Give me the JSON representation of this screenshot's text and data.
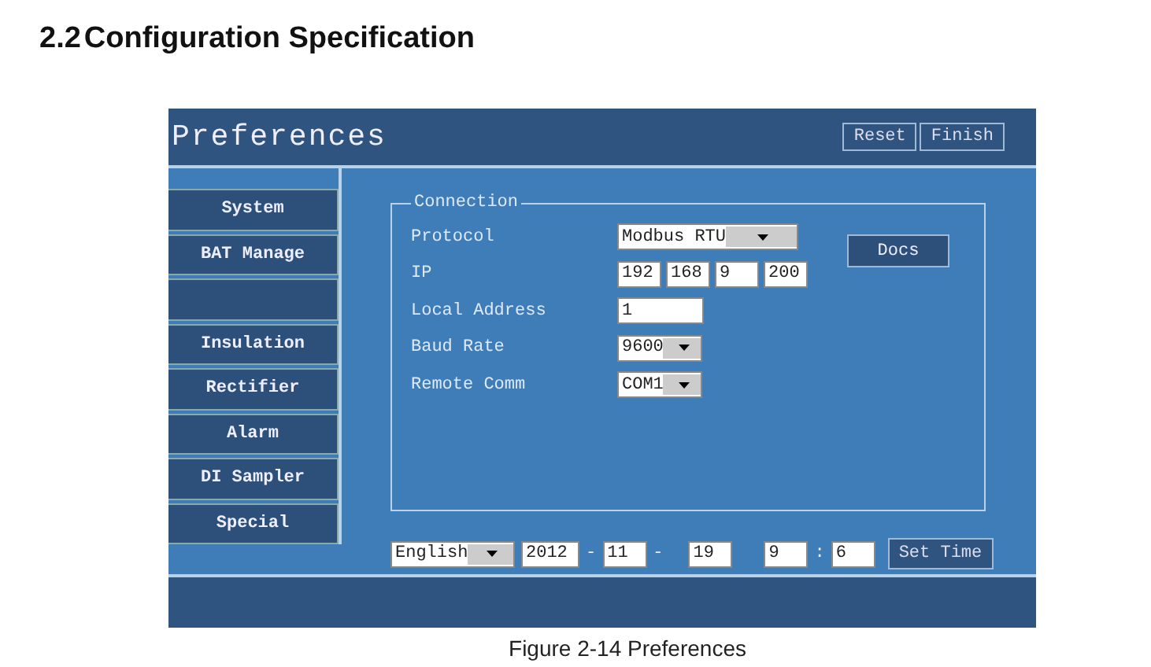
{
  "heading": {
    "number": "2.2",
    "title": "Configuration Specification"
  },
  "window": {
    "title": "Preferences",
    "buttons": [
      "Reset",
      "Finish"
    ]
  },
  "sidebar": {
    "items": [
      {
        "label": "System",
        "selected": false
      },
      {
        "label": "BAT Manage",
        "selected": false
      },
      {
        "selected": false
      },
      {
        "label": "Insulation",
        "selected": false
      },
      {
        "label": "Rectifier",
        "selected": false
      },
      {
        "label": "Alarm",
        "selected": false
      },
      {
        "label": "DI Sampler",
        "selected": false
      },
      {
        "label": "Special",
        "selected": false
      }
    ]
  },
  "connection": {
    "title": "Connection",
    "docs_button": "Docs",
    "rows": [
      {
        "label": "Protocol",
        "kind": "dropdown",
        "value": "Modbus RTU"
      },
      {
        "label": "IP",
        "kind": "ip",
        "parts": [
          "192",
          "168",
          "9",
          "200"
        ]
      },
      {
        "label": "Local Address",
        "kind": "text",
        "value": "1"
      },
      {
        "label": "Baud Rate",
        "kind": "dropdown",
        "value": "9600"
      },
      {
        "label": "Remote Comm",
        "kind": "dropdown",
        "value": "COM1"
      }
    ]
  },
  "footer": {
    "language": "English",
    "year": "2012",
    "month": "11",
    "day": "19",
    "hour": "9",
    "minute": "6",
    "date_separator": "-",
    "time_separator": ":",
    "set_button": "Set Time"
  },
  "caption": "Figure 2-14 Preferences"
}
